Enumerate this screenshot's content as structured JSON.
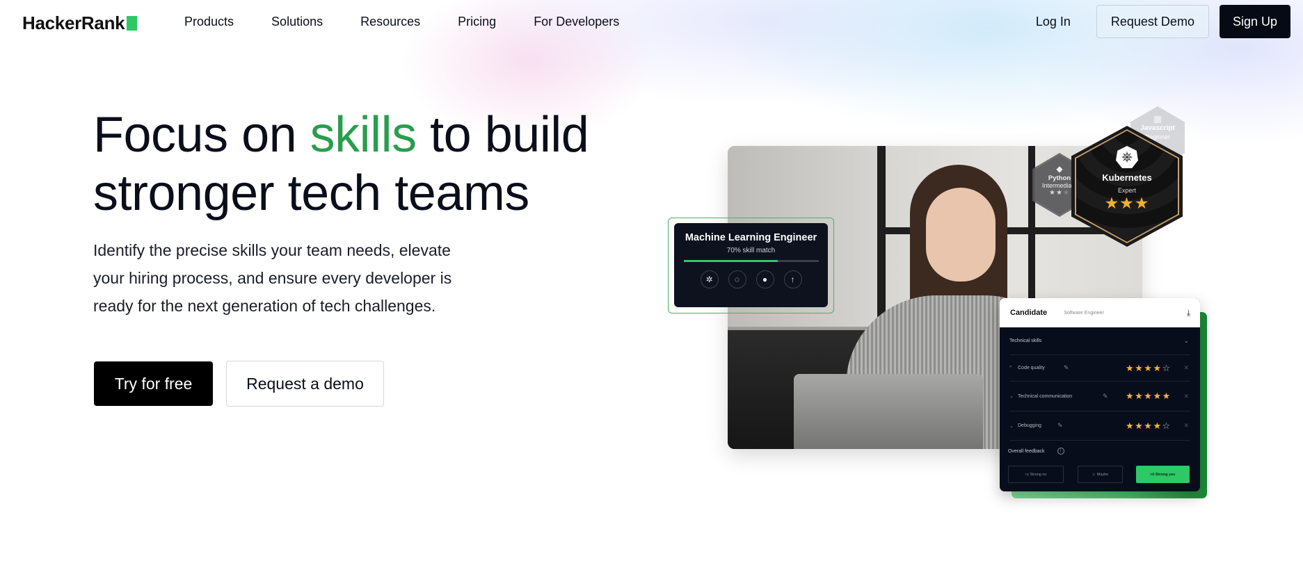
{
  "nav": {
    "logo": "HackerRank",
    "links": [
      "Products",
      "Solutions",
      "Resources",
      "Pricing",
      "For Developers"
    ],
    "login": "Log In",
    "request_demo": "Request Demo",
    "sign_up": "Sign Up"
  },
  "hero": {
    "title_part1": "Focus on ",
    "title_accent": "skills",
    "title_part2": " to build",
    "title_line2": "stronger tech teams",
    "subtitle": "Identify the precise skills your team needs, elevate your hiring process, and ensure every developer is ready for the next generation of tech challenges.",
    "cta_primary": "Try for free",
    "cta_secondary": "Request a demo",
    "accent_color": "#2a9d4e"
  },
  "role_card": {
    "title": "Machine Learning Engineer",
    "match_label": "70% skill match",
    "match_percent": 70,
    "skill_icons": [
      "airflow-icon",
      "pytorch-icon",
      "python-icon",
      "tensorflow-icon"
    ]
  },
  "badges": [
    {
      "skill": "Javascript",
      "level": "Beginner"
    },
    {
      "skill": "Python",
      "level": "Intermediate",
      "stars": 2,
      "max_stars": 3
    },
    {
      "skill": "Kubernetes",
      "level": "Expert",
      "stars": 3,
      "max_stars": 3
    }
  ],
  "candidate_card": {
    "title": "Candidate",
    "role": "Software Engineer",
    "section": "Technical skills",
    "skills": [
      {
        "name": "Code quality",
        "rating": 4,
        "max": 5
      },
      {
        "name": "Technical communication",
        "rating": 5,
        "max": 5
      },
      {
        "name": "Debugging",
        "rating": 4,
        "max": 5
      }
    ],
    "feedback_label": "Overall feedback",
    "feedback_options": [
      "Strong no",
      "Maybe",
      "Strong yes"
    ],
    "selected_feedback": "Strong yes"
  }
}
